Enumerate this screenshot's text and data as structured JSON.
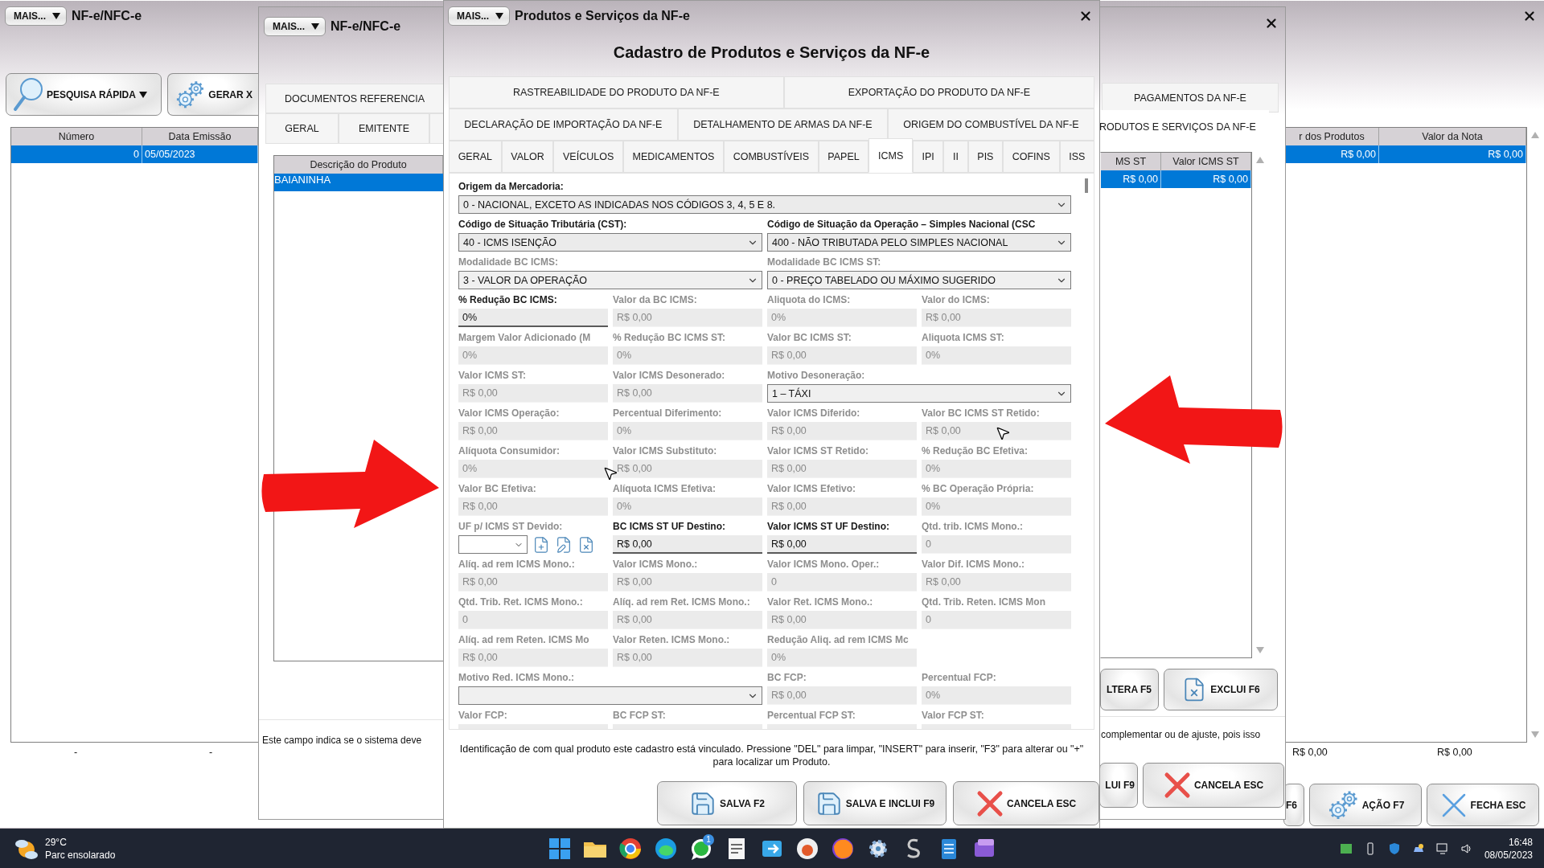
{
  "main_window": {
    "menu_button": "MAIS...",
    "title": "NF-e/NFC-e",
    "toolbar": [
      {
        "kind": "search",
        "label": "PESQUISA RÁPIDA",
        "dropdown": true
      },
      {
        "kind": "gears",
        "label": "GERAR X",
        "dropdown": false
      }
    ],
    "table": {
      "columns": [
        "Número",
        "Data Emissão",
        "r dos Produtos",
        "Valor da Nota"
      ],
      "rows": [
        {
          "selected": true,
          "cells": [
            "0",
            "05/05/2023",
            "R$ 0,00",
            "R$ 0,00"
          ]
        }
      ]
    },
    "totals": [
      "-",
      "-",
      "R$ 0,00",
      "R$ 0,00"
    ],
    "buttons": [
      {
        "kind": "plain",
        "label": "F6"
      },
      {
        "kind": "gears",
        "label": "AÇÃO F7"
      },
      {
        "kind": "close",
        "label": "FECHA ESC"
      }
    ]
  },
  "items_window": {
    "menu_button": "MAIS...",
    "title": "NF-e/NFC-e",
    "tabs_top": [
      {
        "label": "DOCUMENTOS REFERENCIA",
        "selected": false
      },
      {
        "label": "PAGAMENTOS DA NF-E",
        "selected": false
      }
    ],
    "tabs_bottom": [
      {
        "label": "GERAL",
        "selected": false
      },
      {
        "label": "EMITENTE",
        "selected": false
      },
      {
        "label": "RODUTOS E SERVIÇOS DA NF-E",
        "selected": true
      }
    ],
    "table": {
      "columns": [
        "Descrição do Produto",
        "MS ST",
        "Valor ICMS ST"
      ],
      "rows": [
        {
          "selected": true,
          "cells": [
            "BAIANINHA",
            "R$ 0,00",
            "R$ 0,00"
          ]
        }
      ]
    },
    "buttons": [
      {
        "kind": "plain",
        "label": "LTERA F5"
      },
      {
        "kind": "delete",
        "label": "EXCLUI F6"
      }
    ],
    "help": [
      "Este campo indica se o sistema deve",
      "complementar ou de ajuste, pois isso"
    ],
    "bottom_buttons": [
      {
        "kind": "plain",
        "label": "LUI F9"
      },
      {
        "kind": "cancel",
        "label": "CANCELA ESC"
      }
    ]
  },
  "product_dialog": {
    "menu_button": "MAIS...",
    "title": "Produtos e Serviços da NF-e",
    "heading": "Cadastro de Produtos e Serviços da NF-e",
    "tab_rows": [
      {
        "tabs": [
          {
            "label": "RASTREABILIDADE DO PRODUTO DA NF-E",
            "selected": false
          },
          {
            "label": "EXPORTAÇÃO DO PRODUTO DA NF-E",
            "selected": false
          }
        ]
      },
      {
        "tabs": [
          {
            "label": "DECLARAÇÃO DE IMPORTAÇÃO DA NF-E",
            "selected": false
          },
          {
            "label": "DETALHAMENTO DE ARMAS DA NF-E",
            "selected": false
          },
          {
            "label": "ORIGEM DO COMBUSTÍVEL DA NF-E",
            "selected": false
          }
        ]
      },
      {
        "tabs": [
          {
            "label": "GERAL",
            "selected": false
          },
          {
            "label": "VALOR",
            "selected": false
          },
          {
            "label": "VEÍCULOS",
            "selected": false
          },
          {
            "label": "MEDICAMENTOS",
            "selected": false
          },
          {
            "label": "COMBUSTÍVEIS",
            "selected": false
          },
          {
            "label": "PAPEL",
            "selected": false
          },
          {
            "label": "ICMS",
            "selected": true
          },
          {
            "label": "IPI",
            "selected": false
          },
          {
            "label": "II",
            "selected": false
          },
          {
            "label": "PIS",
            "selected": false
          },
          {
            "label": "COFINS",
            "selected": false
          },
          {
            "label": "ISS",
            "selected": false
          }
        ]
      }
    ],
    "fields": [
      {
        "kind": "full_select",
        "label": "Origem da Mercadoria:",
        "value": "0 - NACIONAL, EXCETO AS INDICADAS NOS CÓDIGOS 3, 4, 5 E 8.",
        "disabled": false
      },
      {
        "kind": "wide_select",
        "label": "Código de Situação Tributária (CST):",
        "value": "40 - ICMS ISENÇÃO",
        "disabled": false
      },
      {
        "kind": "wide_select",
        "label": "Código de Situação da Operação – Simples Nacional (CSC",
        "value": "400 - NÃO TRIBUTADA PELO SIMPLES NACIONAL",
        "disabled": false
      },
      {
        "kind": "wide_select",
        "label": "Modalidade BC ICMS:",
        "value": "3 - VALOR DA OPERAÇÃO",
        "disabled": true
      },
      {
        "kind": "wide_select",
        "label": "Modalidade BC ICMS ST:",
        "value": "0 - PREÇO TABELADO OU MÁXIMO SUGERIDO",
        "disabled": true
      },
      {
        "kind": "text",
        "label": "% Redução BC ICMS:",
        "value": "0%",
        "disabled": false
      },
      {
        "kind": "text",
        "label": "Valor da BC ICMS:",
        "value": "R$ 0,00",
        "disabled": true
      },
      {
        "kind": "text",
        "label": "Aliquota do ICMS:",
        "value": "0%",
        "disabled": true
      },
      {
        "kind": "text",
        "label": "Valor do ICMS:",
        "value": "R$ 0,00",
        "disabled": true
      },
      {
        "kind": "text",
        "label": "Margem Valor Adicionado (M",
        "value": "0%",
        "disabled": true
      },
      {
        "kind": "text",
        "label": "% Redução BC ICMS ST:",
        "value": "0%",
        "disabled": true
      },
      {
        "kind": "text",
        "label": "Valor BC ICMS ST:",
        "value": "R$ 0,00",
        "disabled": true
      },
      {
        "kind": "text",
        "label": "Aliquota ICMS ST:",
        "value": "0%",
        "disabled": true
      },
      {
        "kind": "text",
        "label": "Valor ICMS ST:",
        "value": "R$ 0,00",
        "disabled": true
      },
      {
        "kind": "text",
        "label": "Valor ICMS Desonerado:",
        "value": "R$ 0,00",
        "disabled": true
      },
      {
        "kind": "wide_select",
        "label": "Motivo Desoneração:",
        "value": "1 – TÁXI",
        "disabled": true
      },
      {
        "kind": "text",
        "label": "Valor ICMS Operação:",
        "value": "R$ 0,00",
        "disabled": true
      },
      {
        "kind": "text",
        "label": "Percentual Diferimento:",
        "value": "0%",
        "disabled": true
      },
      {
        "kind": "text",
        "label": "Valor ICMS Diferido:",
        "value": "R$ 0,00",
        "disabled": true
      },
      {
        "kind": "text",
        "label": "Valor BC ICMS ST Retido:",
        "value": "R$ 0,00",
        "disabled": true
      },
      {
        "kind": "text",
        "label": "Alíquota Consumidor:",
        "value": "0%",
        "disabled": true
      },
      {
        "kind": "text",
        "label": "Valor ICMS Substituto:",
        "value": "R$ 0,00",
        "disabled": true
      },
      {
        "kind": "text",
        "label": "Valor ICMS ST Retido:",
        "value": "R$ 0,00",
        "disabled": true
      },
      {
        "kind": "text",
        "label": "% Redução BC Efetiva:",
        "value": "0%",
        "disabled": true
      },
      {
        "kind": "text",
        "label": "Valor BC Efetiva:",
        "value": "R$ 0,00",
        "disabled": true
      },
      {
        "kind": "text",
        "label": "Alíquota ICMS Efetiva:",
        "value": "0%",
        "disabled": true
      },
      {
        "kind": "text",
        "label": "Valor ICMS Efetivo:",
        "value": "R$ 0,00",
        "disabled": true
      },
      {
        "kind": "text",
        "label": "% BC Operação Própria:",
        "value": "0%",
        "disabled": true
      },
      {
        "kind": "uf_select",
        "label": "UF p/ ICMS ST Devido:",
        "disabled": true
      },
      {
        "kind": "text",
        "label": "BC ICMS ST UF Destino:",
        "value": "R$ 0,00",
        "disabled": false
      },
      {
        "kind": "text",
        "label": "Valor ICMS ST UF Destino:",
        "value": "R$ 0,00",
        "disabled": false
      },
      {
        "kind": "text",
        "label": "Qtd. trib. ICMS Mono.:",
        "value": "0",
        "disabled": true
      },
      {
        "kind": "text",
        "label": "Alíq. ad rem ICMS Mono.:",
        "value": "R$ 0,00",
        "disabled": true
      },
      {
        "kind": "text",
        "label": "Valor ICMS Mono.:",
        "value": "R$ 0,00",
        "disabled": true
      },
      {
        "kind": "text",
        "label": "Valor ICMS Mono. Oper.:",
        "value": "0",
        "disabled": true
      },
      {
        "kind": "text",
        "label": "Valor Dif. ICMS Mono.:",
        "value": "R$ 0,00",
        "disabled": true
      },
      {
        "kind": "text",
        "label": "Qtd. Trib. Ret. ICMS Mono.:",
        "value": "0",
        "disabled": true
      },
      {
        "kind": "text",
        "label": "Alíq. ad rem Ret. ICMS Mono.:",
        "value": "R$ 0,00",
        "disabled": true
      },
      {
        "kind": "text",
        "label": "Valor Ret. ICMS Mono.:",
        "value": "R$ 0,00",
        "disabled": true
      },
      {
        "kind": "text",
        "label": "Qtd. Trib. Reten. ICMS Mon",
        "value": "0",
        "disabled": true
      },
      {
        "kind": "text",
        "label": "Alíq. ad rem Reten. ICMS Mo",
        "value": "R$ 0,00",
        "disabled": true
      },
      {
        "kind": "text",
        "label": "Valor Reten. ICMS Mono.:",
        "value": "R$ 0,00",
        "disabled": true
      },
      {
        "kind": "text",
        "label": "Redução Aliq. ad rem ICMS Mc",
        "value": "0%",
        "disabled": true
      },
      {
        "kind": "blank"
      },
      {
        "kind": "wide_select",
        "label": "Motivo Red. ICMS Mono.:",
        "disabled": true
      },
      {
        "kind": "text",
        "label": "BC FCP:",
        "value": "R$ 0,00",
        "disabled": true
      },
      {
        "kind": "text",
        "label": "Percentual FCP:",
        "value": "0%",
        "disabled": true
      },
      {
        "kind": "text",
        "label": "Valor FCP:",
        "disabled": true
      },
      {
        "kind": "text",
        "label": "BC FCP ST:",
        "disabled": true
      },
      {
        "kind": "text",
        "label": "Percentual FCP ST:",
        "disabled": true
      },
      {
        "kind": "text",
        "label": "Valor FCP ST:",
        "disabled": true
      }
    ],
    "help": "Identificação de com qual produto este cadastro está vinculado. Pressione \"DEL\" para limpar, \"INSERT\" para inserir, \"F3\" para alterar ou \"+\" para localizar um Produto.",
    "buttons": [
      {
        "kind": "save",
        "label": "SALVA F2"
      },
      {
        "kind": "save",
        "label": "SALVA E INCLUI F9"
      },
      {
        "kind": "cancel",
        "label": "CANCELA ESC"
      }
    ]
  },
  "taskbar": {
    "temperature": "29°C",
    "weather": "Parc ensolarado",
    "chat_badge": "1",
    "time": "16:48",
    "date": "08/05/2023"
  }
}
